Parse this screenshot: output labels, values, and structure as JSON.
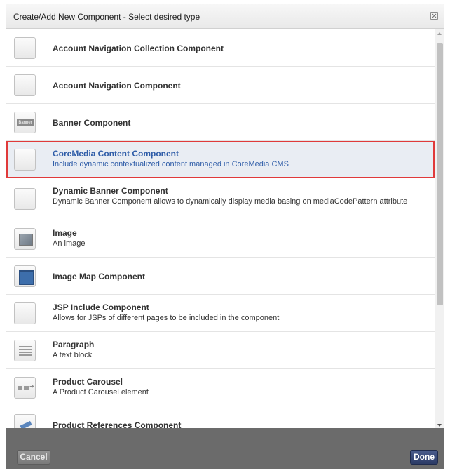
{
  "dialog": {
    "title": "Create/Add New Component - Select desired type",
    "close_icon": "close-icon"
  },
  "components": [
    {
      "name": "Account Navigation Collection Component",
      "description": "",
      "icon": "blank-component-icon"
    },
    {
      "name": "Account Navigation Component",
      "description": "",
      "icon": "blank-component-icon"
    },
    {
      "name": "Banner Component",
      "description": "",
      "icon": "banner-icon"
    },
    {
      "name": "CoreMedia Content Component",
      "description": "Include dynamic contextualized content managed in CoreMedia CMS",
      "icon": "blank-component-icon",
      "selected": true
    },
    {
      "name": "Dynamic Banner Component",
      "description": "Dynamic Banner Component allows to dynamically display media basing on mediaCodePattern attribute",
      "icon": "blank-component-icon"
    },
    {
      "name": "Image",
      "description": "An image",
      "icon": "image-icon"
    },
    {
      "name": "Image Map Component",
      "description": "",
      "icon": "image-map-icon"
    },
    {
      "name": "JSP Include Component",
      "description": "Allows for JSPs of different pages to be included in the component",
      "icon": "blank-component-icon"
    },
    {
      "name": "Paragraph",
      "description": "A text block",
      "icon": "paragraph-icon"
    },
    {
      "name": "Product Carousel",
      "description": "A Product Carousel element",
      "icon": "carousel-icon"
    },
    {
      "name": "Product References Component",
      "description": "",
      "icon": "product-references-icon"
    }
  ],
  "footer": {
    "cancel_label": "Cancel",
    "done_label": "Done"
  },
  "colors": {
    "selected_text": "#2f5da8",
    "selected_outline": "#e03a3a",
    "footer_bg": "#6b6b6b",
    "done_bg": "#2c3b66"
  }
}
